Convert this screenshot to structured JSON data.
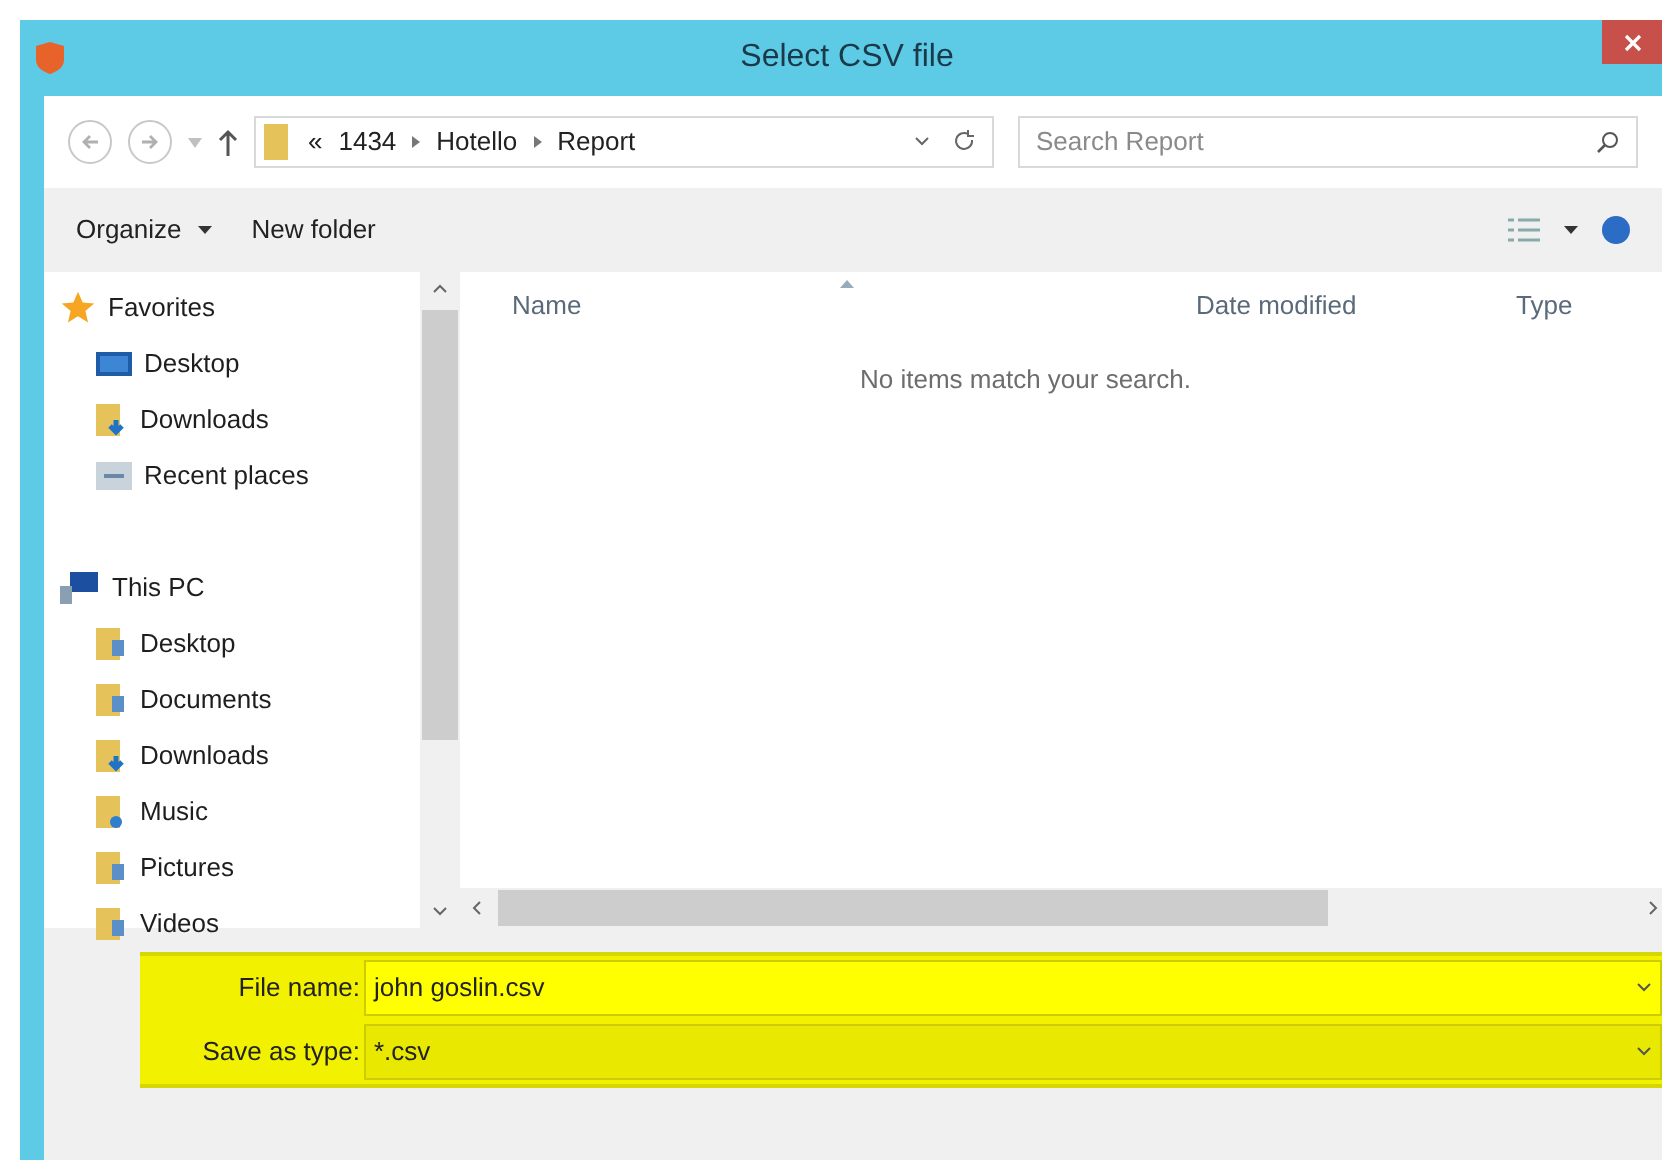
{
  "window": {
    "title": "Select CSV file"
  },
  "address_bar": {
    "path": [
      {
        "label": "«"
      },
      {
        "label": "1434"
      },
      {
        "label": "Hotello"
      },
      {
        "label": "Report"
      }
    ]
  },
  "search": {
    "placeholder": "Search Report"
  },
  "command_bar": {
    "organize": "Organize",
    "new_folder": "New folder"
  },
  "navigation": [
    {
      "label": "Favorites",
      "kind": "star",
      "children": [
        {
          "label": "Desktop",
          "kind": "desktop"
        },
        {
          "label": "Downloads",
          "kind": "download"
        },
        {
          "label": "Recent places",
          "kind": "recent"
        }
      ]
    },
    {
      "label": "This PC",
      "kind": "pc",
      "children": [
        {
          "label": "Desktop",
          "kind": "folder"
        },
        {
          "label": "Documents",
          "kind": "folder"
        },
        {
          "label": "Downloads",
          "kind": "download"
        },
        {
          "label": "Music",
          "kind": "music"
        },
        {
          "label": "Pictures",
          "kind": "folder"
        },
        {
          "label": "Videos",
          "kind": "folder"
        }
      ]
    }
  ],
  "columns": [
    "Name",
    "Date modified",
    "Type"
  ],
  "empty_message": "No items match your search.",
  "file_name": {
    "label": "File name:",
    "value": "john goslin.csv"
  },
  "save_as_type": {
    "label": "Save as type:",
    "value": "*.csv"
  }
}
